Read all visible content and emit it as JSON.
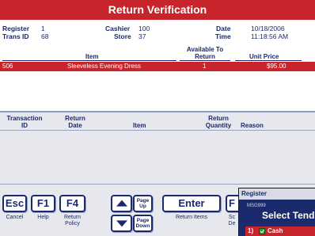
{
  "window": {
    "title": "Return Verification"
  },
  "info": {
    "register_label": "Register",
    "register_value": "1",
    "trans_label": "Trans ID",
    "trans_value": "68",
    "cashier_label": "Cashier",
    "cashier_value": "100",
    "store_label": "Store",
    "store_value": "37",
    "date_label": "Date",
    "date_value": "10/18/2006",
    "time_label": "Time",
    "time_value": "11:18:56 AM"
  },
  "items_table": {
    "headers": {
      "item": "Item",
      "available": "Available To\nReturn",
      "price": "Unit Price"
    },
    "rows": [
      {
        "id": "506",
        "item": "Sleeveless Evening Dress",
        "available": "1",
        "price": "$95.00"
      }
    ]
  },
  "returns_table": {
    "headers": {
      "transaction_id": "Transaction\nID",
      "return_date": "Return\nDate",
      "item": "Item",
      "return_quantity": "Return\nQuantity",
      "reason": "Reason"
    },
    "rows": []
  },
  "buttons": {
    "esc": {
      "key": "Esc",
      "caption": "Cancel"
    },
    "f1": {
      "key": "F1",
      "caption": "Help"
    },
    "f4": {
      "key": "F4",
      "caption": "Return\nPolicy"
    },
    "page_up": {
      "key": "Page\nUp"
    },
    "page_down": {
      "key": "Page\nDown"
    },
    "enter": {
      "key": "Enter",
      "caption": "Return Items"
    },
    "f_partial": {
      "key": "F",
      "caption": "Sc\nDe"
    }
  },
  "tender_popup": {
    "title": "Register",
    "code": "MSG999",
    "heading": "Select Tende",
    "options": [
      {
        "number": "1)",
        "label": "Cash"
      }
    ]
  },
  "colors": {
    "title_bar": "#c8242c",
    "selected_row": "#c8242c",
    "text_navy": "#1a2a6c",
    "panel_gray": "#e6e8ee",
    "popup_bg": "#1a2a6c"
  }
}
